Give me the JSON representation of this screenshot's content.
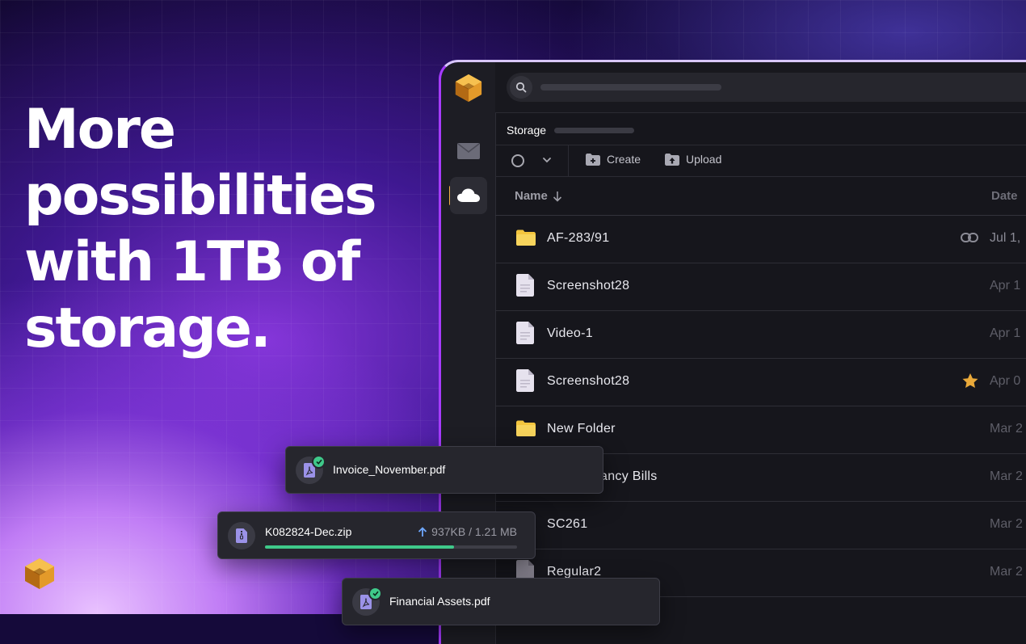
{
  "headline": "More\npossibilities\nwith 1TB of\nstorage.",
  "colors": {
    "accent": "#a73bff",
    "progress": "#3fc98a",
    "star": "#e9a93a",
    "folder": "#f3c53e"
  },
  "sidebar": {
    "items": [
      {
        "icon": "mail-icon",
        "active": false
      },
      {
        "icon": "cloud-icon",
        "active": true
      }
    ]
  },
  "breadcrumb": {
    "title": "Storage"
  },
  "toolbar": {
    "create_label": "Create",
    "upload_label": "Upload"
  },
  "table": {
    "columns": {
      "name": "Name",
      "date": "Date"
    },
    "rows": [
      {
        "name": "AF-283/91",
        "type": "folder",
        "date": "Jul 1,",
        "shared": true
      },
      {
        "name": "Screenshot28",
        "type": "file",
        "date": "Apr 1"
      },
      {
        "name": "Video-1",
        "type": "file",
        "date": "Apr 1"
      },
      {
        "name": "Screenshot28",
        "type": "file",
        "date": "Apr 0",
        "starred": true
      },
      {
        "name": "New Folder",
        "type": "folder",
        "date": "Mar 2"
      },
      {
        "name": "ancy Bills",
        "type": "file",
        "date": "Mar 2"
      },
      {
        "name": "SC261",
        "type": "file",
        "date": "Mar 2"
      },
      {
        "name": "Regular2",
        "type": "file",
        "date": "Mar 2"
      }
    ]
  },
  "uploads": [
    {
      "name": "Invoice_November.pdf",
      "status": "done",
      "icon": "pdf-icon"
    },
    {
      "name": "K082824-Dec.zip",
      "status": "uploading",
      "progress_text": "937KB / 1.21 MB",
      "progress": 0.75,
      "icon": "zip-icon"
    },
    {
      "name": "Financial Assets.pdf",
      "status": "done",
      "icon": "pdf-icon"
    }
  ]
}
